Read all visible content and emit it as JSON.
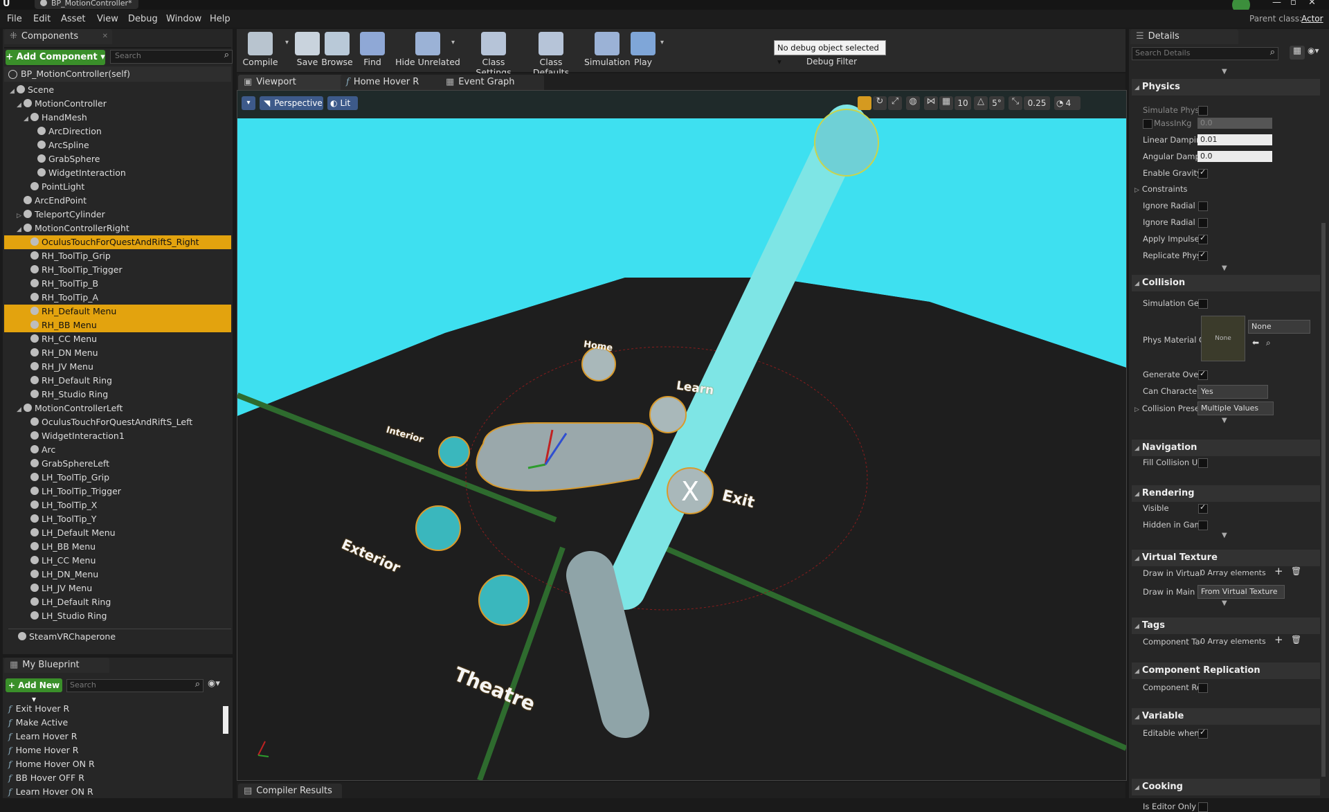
{
  "window": {
    "title": "BP_MotionController*",
    "parent_class_label": "Parent class:",
    "parent_class": "Actor"
  },
  "menu": [
    "File",
    "Edit",
    "Asset",
    "View",
    "Debug",
    "Window",
    "Help"
  ],
  "components_panel": {
    "tab": "Components",
    "add_button": "+ Add Component ▾",
    "search_placeholder": "Search",
    "self_label": "BP_MotionController(self)",
    "tree": [
      {
        "label": "Scene",
        "depth": 0,
        "expander": "◢",
        "selected": false
      },
      {
        "label": "MotionController",
        "depth": 1,
        "expander": "◢",
        "selected": false
      },
      {
        "label": "HandMesh",
        "depth": 2,
        "expander": "◢",
        "selected": false
      },
      {
        "label": "ArcDirection",
        "depth": 3,
        "expander": "",
        "selected": false
      },
      {
        "label": "ArcSpline",
        "depth": 3,
        "expander": "",
        "selected": false
      },
      {
        "label": "GrabSphere",
        "depth": 3,
        "expander": "",
        "selected": false
      },
      {
        "label": "WidgetInteraction",
        "depth": 3,
        "expander": "",
        "selected": false
      },
      {
        "label": "PointLight",
        "depth": 2,
        "expander": "",
        "selected": false
      },
      {
        "label": "ArcEndPoint",
        "depth": 1,
        "expander": "",
        "selected": false
      },
      {
        "label": "TeleportCylinder",
        "depth": 1,
        "expander": "▷",
        "selected": false
      },
      {
        "label": "MotionControllerRight",
        "depth": 1,
        "expander": "◢",
        "selected": false
      },
      {
        "label": "OculusTouchForQuestAndRiftS_Right",
        "depth": 2,
        "expander": "",
        "selected": true
      },
      {
        "label": "RH_ToolTip_Grip",
        "depth": 2,
        "expander": "",
        "selected": false
      },
      {
        "label": "RH_ToolTip_Trigger",
        "depth": 2,
        "expander": "",
        "selected": false
      },
      {
        "label": "RH_ToolTip_B",
        "depth": 2,
        "expander": "",
        "selected": false
      },
      {
        "label": "RH_ToolTip_A",
        "depth": 2,
        "expander": "",
        "selected": false
      },
      {
        "label": "RH_Default Menu",
        "depth": 2,
        "expander": "",
        "selected": true
      },
      {
        "label": "RH_BB Menu",
        "depth": 2,
        "expander": "",
        "selected": true
      },
      {
        "label": "RH_CC Menu",
        "depth": 2,
        "expander": "",
        "selected": false
      },
      {
        "label": "RH_DN Menu",
        "depth": 2,
        "expander": "",
        "selected": false
      },
      {
        "label": "RH_JV Menu",
        "depth": 2,
        "expander": "",
        "selected": false
      },
      {
        "label": "RH_Default Ring",
        "depth": 2,
        "expander": "",
        "selected": false
      },
      {
        "label": "RH_Studio Ring",
        "depth": 2,
        "expander": "",
        "selected": false
      },
      {
        "label": "MotionControllerLeft",
        "depth": 1,
        "expander": "◢",
        "selected": false
      },
      {
        "label": "OculusTouchForQuestAndRiftS_Left",
        "depth": 2,
        "expander": "",
        "selected": false
      },
      {
        "label": "WidgetInteraction1",
        "depth": 2,
        "expander": "",
        "selected": false
      },
      {
        "label": "Arc",
        "depth": 2,
        "expander": "",
        "selected": false
      },
      {
        "label": "GrabSphereLeft",
        "depth": 2,
        "expander": "",
        "selected": false
      },
      {
        "label": "LH_ToolTip_Grip",
        "depth": 2,
        "expander": "",
        "selected": false
      },
      {
        "label": "LH_ToolTip_Trigger",
        "depth": 2,
        "expander": "",
        "selected": false
      },
      {
        "label": "LH_ToolTip_X",
        "depth": 2,
        "expander": "",
        "selected": false
      },
      {
        "label": "LH_ToolTip_Y",
        "depth": 2,
        "expander": "",
        "selected": false
      },
      {
        "label": "LH_Default Menu",
        "depth": 2,
        "expander": "",
        "selected": false
      },
      {
        "label": "LH_BB Menu",
        "depth": 2,
        "expander": "",
        "selected": false
      },
      {
        "label": "LH_CC Menu",
        "depth": 2,
        "expander": "",
        "selected": false
      },
      {
        "label": "LH_DN_Menu",
        "depth": 2,
        "expander": "",
        "selected": false
      },
      {
        "label": "LH_JV Menu",
        "depth": 2,
        "expander": "",
        "selected": false
      },
      {
        "label": "LH_Default Ring",
        "depth": 2,
        "expander": "",
        "selected": false
      },
      {
        "label": "LH_Studio Ring",
        "depth": 2,
        "expander": "",
        "selected": false
      }
    ],
    "footer_item": "SteamVRChaperone"
  },
  "blueprint_panel": {
    "tab": "My Blueprint",
    "add_button": "+ Add New ▾",
    "search_placeholder": "Search",
    "functions": [
      "Exit Hover R",
      "Make Active",
      "Learn Hover R",
      "Home Hover R",
      "Home Hover ON R",
      "BB Hover OFF R",
      "Learn Hover ON R"
    ]
  },
  "toolbar": {
    "buttons": [
      {
        "label": "Compile",
        "color": "#b8c4cf"
      },
      {
        "label": "Save",
        "color": "#c9d3dd"
      },
      {
        "label": "Browse",
        "color": "#b9c9d8"
      },
      {
        "label": "Find",
        "color": "#8fa8d6"
      },
      {
        "label": "Hide Unrelated",
        "color": "#9bb2d6"
      },
      {
        "label": "Class Settings",
        "color": "#b6c4d8"
      },
      {
        "label": "Class Defaults",
        "color": "#b6c4d8"
      },
      {
        "label": "Simulation",
        "color": "#9bb2d6"
      },
      {
        "label": "Play",
        "color": "#7fa6d8"
      }
    ],
    "debug_select": "No debug object selected ▾",
    "debug_filter": "Debug Filter"
  },
  "editor_tabs": [
    "Viewport",
    "Home Hover R",
    "Event Graph"
  ],
  "viewport": {
    "perspective": "Perspective",
    "lit": "Lit",
    "grid_snap": "10",
    "rot_snap": "5°",
    "scale_snap": "0.25",
    "camera_speed": "4",
    "menu_labels": [
      "Home",
      "Learn",
      "Exit",
      "Interior",
      "Exterior",
      "Theatre"
    ]
  },
  "details": {
    "tab": "Details",
    "search_placeholder": "Search Details",
    "physics": {
      "title": "Physics",
      "simulate": "Simulate Physi",
      "mass_label": "MassInKg",
      "mass_value": "0.0",
      "linear_damping_label": "Linear Damping",
      "linear_damping": "0.01",
      "angular_damping_label": "Angular Dampir",
      "angular_damping": "0.0",
      "enable_gravity": "Enable Gravity",
      "constraints": "Constraints",
      "ignore_radial_impulse": "Ignore Radial In",
      "ignore_radial_force": "Ignore Radial Fo",
      "apply_impulse": "Apply Impulse c",
      "replicate": "Replicate Physi"
    },
    "collision": {
      "title": "Collision",
      "sim_gen": "Simulation Gen",
      "phys_material": "Phys Material C",
      "phys_material_thumb": "None",
      "phys_material_value": "None",
      "generate_overlap": "Generate Overl",
      "can_character": "Can Character S",
      "can_character_value": "Yes",
      "collision_preset": "Collision Prese",
      "collision_preset_value": "Multiple Values"
    },
    "navigation": {
      "title": "Navigation",
      "fill": "Fill Collision Un"
    },
    "rendering": {
      "title": "Rendering",
      "visible": "Visible",
      "hidden": "Hidden in Game"
    },
    "virtual_texture": {
      "title": "Virtual Texture",
      "draw_in": "Draw in Virtual",
      "draw_in_value": "0 Array elements",
      "draw_main": "Draw in Main Pa",
      "draw_main_value": "From Virtual Texture"
    },
    "tags": {
      "title": "Tags",
      "component": "Component Tag",
      "value": "0 Array elements"
    },
    "replication": {
      "title": "Component Replication",
      "label": "Component Rep"
    },
    "variable": {
      "title": "Variable",
      "label": "Editable when I"
    },
    "cooking": {
      "title": "Cooking",
      "label": "Is Editor Only"
    }
  },
  "bottom_tab": "Compiler Results"
}
